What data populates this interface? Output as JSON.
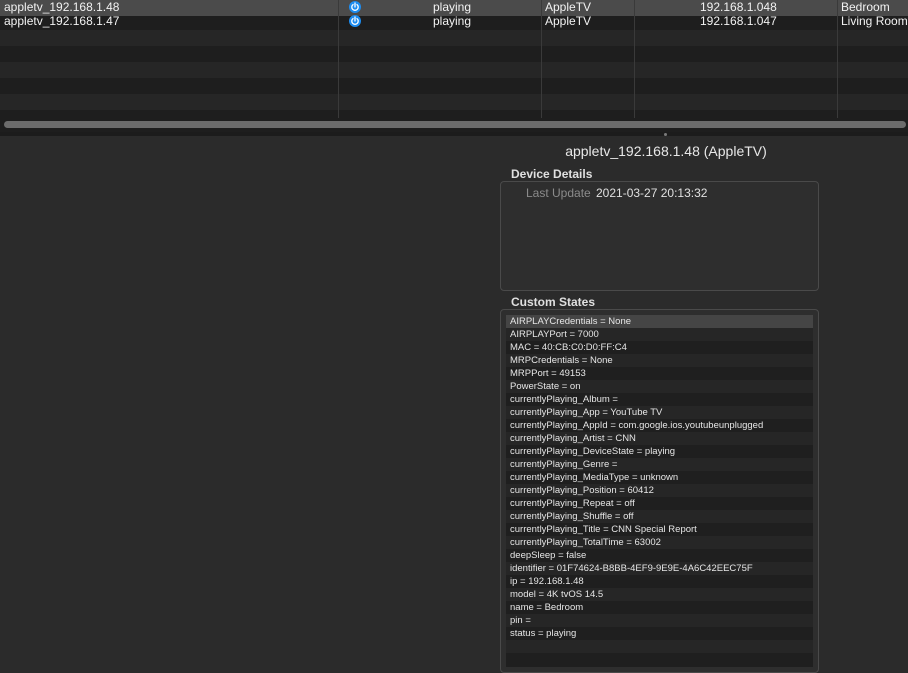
{
  "devices": {
    "rows": [
      {
        "name": "appletv_192.168.1.48",
        "icon": "power-icon",
        "state": "playing",
        "model": "AppleTV",
        "address": "192.168.1.048",
        "room": "Bedroom"
      },
      {
        "name": "appletv_192.168.1.47",
        "icon": "power-icon",
        "state": "playing",
        "model": "AppleTV",
        "address": "192.168.1.047",
        "room": "Living Room"
      }
    ]
  },
  "detail": {
    "title": "appletv_192.168.1.48 (AppleTV)",
    "device_details_label": "Device Details",
    "last_update_label": "Last Update",
    "last_update_value": "2021-03-27 20:13:32",
    "custom_states_label": "Custom States",
    "states": [
      "AIRPLAYCredentials = None",
      "AIRPLAYPort = 7000",
      "MAC = 40:CB:C0:D0:FF:C4",
      "MRPCredentials = None",
      "MRPPort = 49153",
      "PowerState = on",
      "currentlyPlaying_Album =",
      "currentlyPlaying_App = YouTube TV",
      "currentlyPlaying_AppId = com.google.ios.youtubeunplugged",
      "currentlyPlaying_Artist = CNN",
      "currentlyPlaying_DeviceState = playing",
      "currentlyPlaying_Genre =",
      "currentlyPlaying_MediaType = unknown",
      "currentlyPlaying_Position = 60412",
      "currentlyPlaying_Repeat = off",
      "currentlyPlaying_Shuffle = off",
      "currentlyPlaying_Title = CNN Special Report",
      "currentlyPlaying_TotalTime = 63002",
      "deepSleep = false",
      "identifier = 01F74624-B8BB-4EF9-9E9E-4A6C42EEC75F",
      "ip = 192.168.1.48",
      "model = 4K tvOS 14.5",
      "name = Bedroom",
      "pin =",
      "status = playing"
    ]
  },
  "colors": {
    "accent": "#1d8cf0",
    "selected_row": "#4b4b4b",
    "background": "#2b2b2b"
  }
}
